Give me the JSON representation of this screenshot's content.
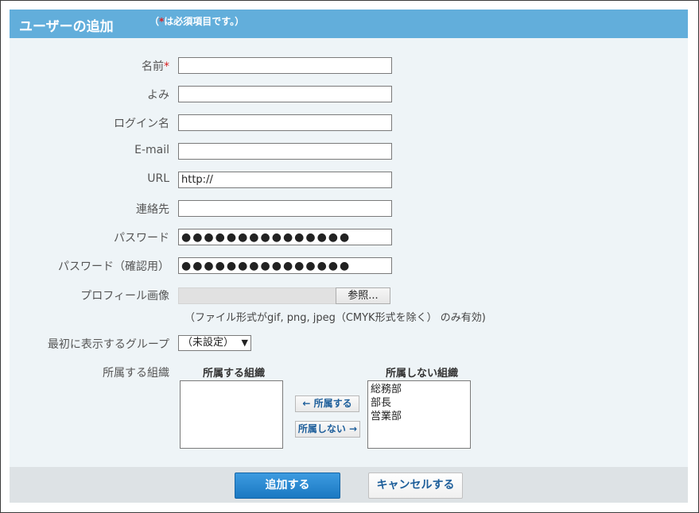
{
  "header": {
    "title": "ユーザーの追加",
    "note_open": "（",
    "note_star": "*",
    "note_text": "は必須項目です。）"
  },
  "form": {
    "name_label": "名前",
    "required_mark": "*",
    "yomi_label": "よみ",
    "login_label": "ログイン名",
    "email_label": "E-mail",
    "url_label": "URL",
    "url_value": "http://",
    "contact_label": "連絡先",
    "password_label": "パスワード",
    "password_mask": "●●●●●●●●●●●●●●●",
    "password_confirm_label": "パスワード（確認用）",
    "password_confirm_mask": "●●●●●●●●●●●●●●●",
    "profile_image_label": "プロフィール画像",
    "browse_button": "参照...",
    "file_note": "（ファイル形式がgif, png, jpeg（CMYK形式を除く） のみ有効)",
    "first_group_label": "最初に表示するグループ",
    "first_group_value": "（未設定）",
    "org_label": "所属する組織"
  },
  "orgs": {
    "member_header": "所属する組織",
    "nonmember_header": "所属しない組織",
    "add_button": "← 所属する",
    "remove_button": "所属しない →",
    "nonmember_items": [
      "総務部",
      "部長",
      "営業部"
    ]
  },
  "footer": {
    "submit": "追加する",
    "cancel": "キャンセルする"
  }
}
